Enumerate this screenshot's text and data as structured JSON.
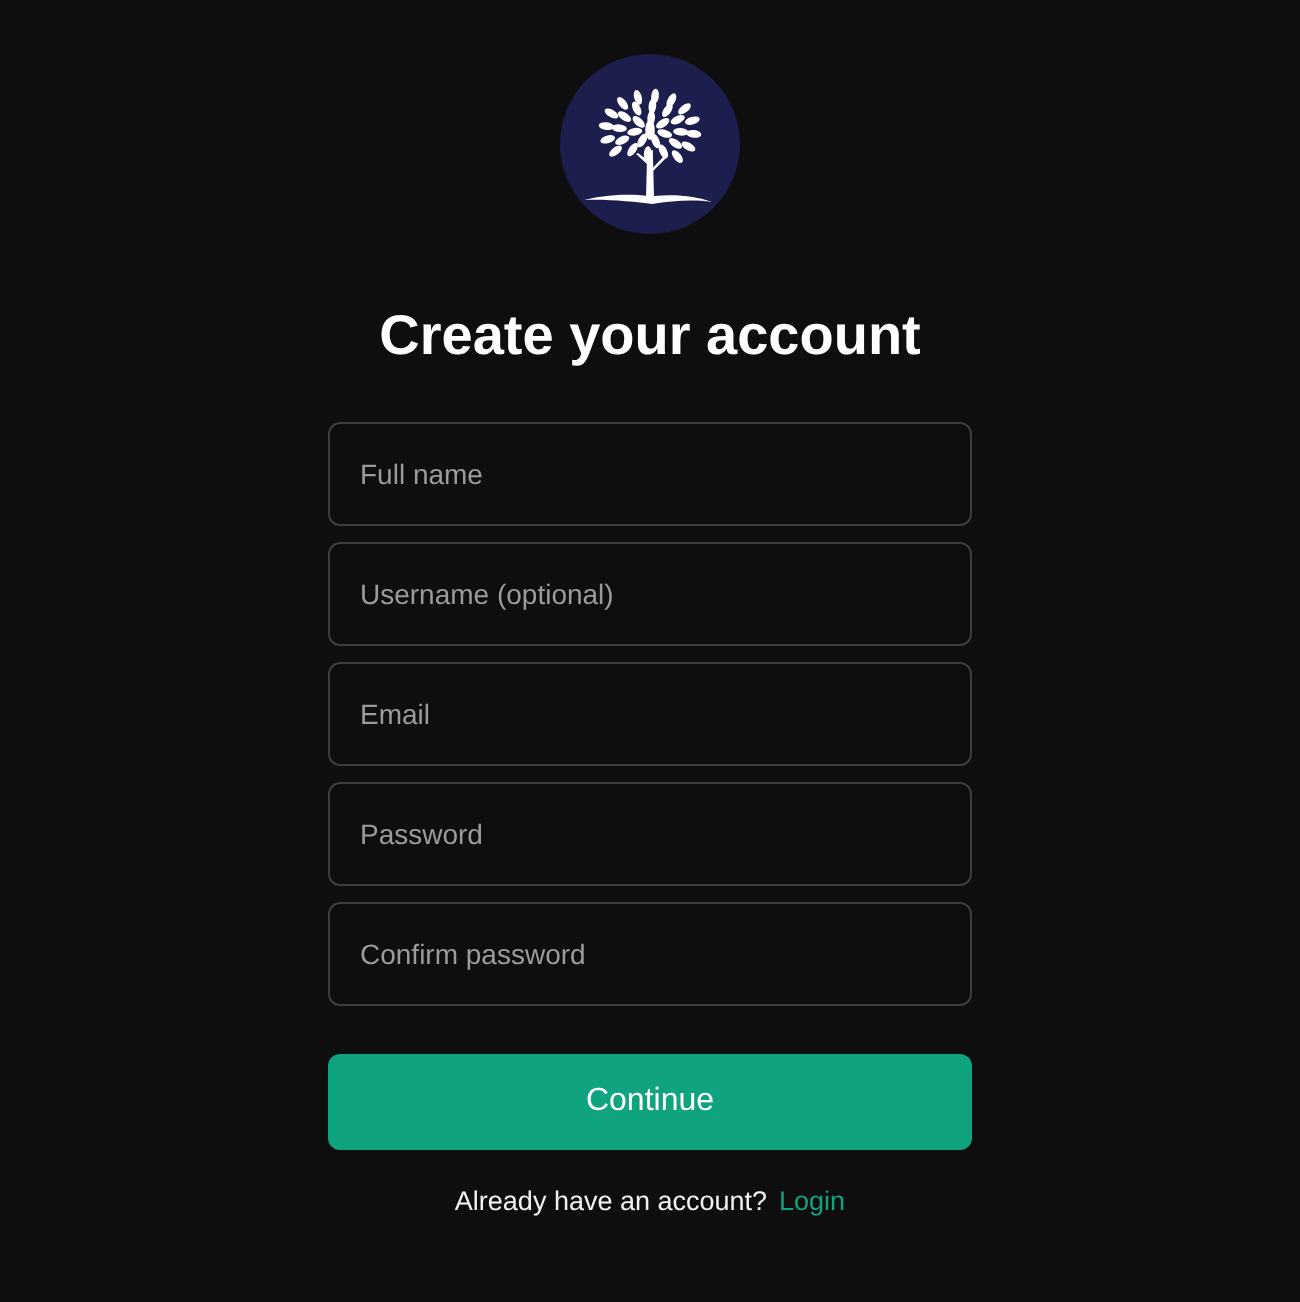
{
  "title": "Create your account",
  "fields": [
    {
      "placeholder": "Full name"
    },
    {
      "placeholder": "Username (optional)"
    },
    {
      "placeholder": "Email"
    },
    {
      "placeholder": "Password"
    },
    {
      "placeholder": "Confirm password"
    }
  ],
  "submit": {
    "label": "Continue"
  },
  "footer": {
    "text": "Already have an account?",
    "link": "Login"
  }
}
